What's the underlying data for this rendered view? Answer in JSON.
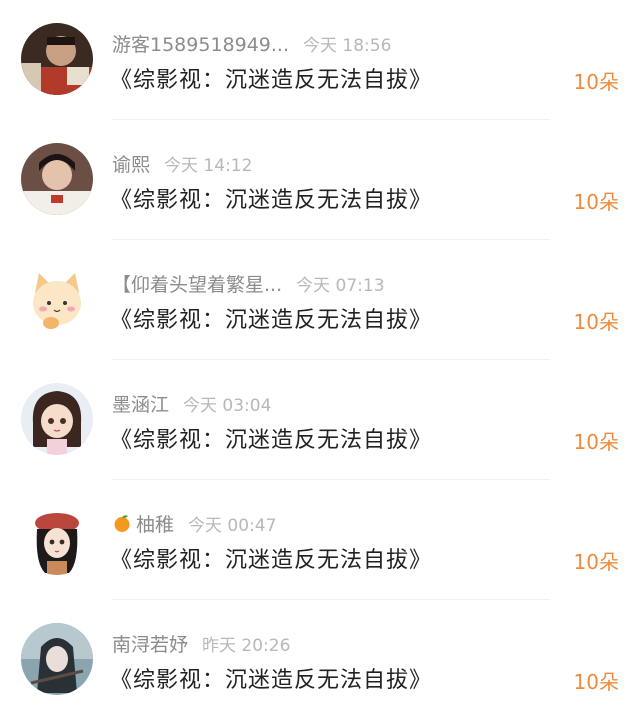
{
  "items": [
    {
      "name": "游客1589518949...",
      "time": "今天 18:56",
      "title": "《综影视：沉迷造反无法自拔》",
      "count": "10朵",
      "avatar_icon": "avatar-photo-man"
    },
    {
      "name": "谕熙",
      "time": "今天 14:12",
      "title": "《综影视：沉迷造反无法自拔》",
      "count": "10朵",
      "avatar_icon": "avatar-photo-actor"
    },
    {
      "name": "【仰着头望着繁星...",
      "time": "今天 07:13",
      "title": "《综影视：沉迷造反无法自拔》",
      "count": "10朵",
      "avatar_icon": "avatar-cartoon-cat"
    },
    {
      "name": "墨涵江",
      "time": "今天 03:04",
      "title": "《综影视：沉迷造反无法自拔》",
      "count": "10朵",
      "avatar_icon": "avatar-anime-girl"
    },
    {
      "name": "柚稚",
      "badge_icon": "tangerine-emoji",
      "time": "今天 00:47",
      "title": "《综影视：沉迷造反无法自拔》",
      "count": "10朵",
      "avatar_icon": "avatar-anime-girl-hat"
    },
    {
      "name": "南浔若妤",
      "time": "昨天 20:26",
      "title": "《综影视：沉迷造反无法自拔》",
      "count": "10朵",
      "avatar_icon": "avatar-fantasy-girl"
    }
  ],
  "colors": {
    "accent": "#f08a3c",
    "name": "#8c8c8c",
    "time": "#b8b8b8",
    "title": "#222222"
  }
}
